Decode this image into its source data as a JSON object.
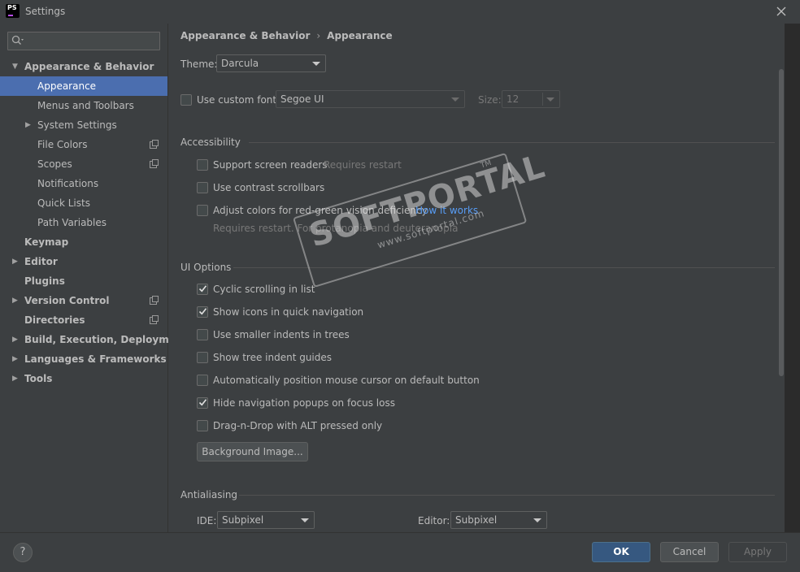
{
  "window": {
    "title": "Settings",
    "app_badge": "PS"
  },
  "sidebar": {
    "search_placeholder": "",
    "items": [
      {
        "label": "Appearance & Behavior",
        "level": 0,
        "bold": true,
        "arrow": "expanded"
      },
      {
        "label": "Appearance",
        "level": 1,
        "selected": true
      },
      {
        "label": "Menus and Toolbars",
        "level": 1
      },
      {
        "label": "System Settings",
        "level": 1,
        "arrow": "collapsed"
      },
      {
        "label": "File Colors",
        "level": 1,
        "project_icon": true
      },
      {
        "label": "Scopes",
        "level": 1,
        "project_icon": true
      },
      {
        "label": "Notifications",
        "level": 1
      },
      {
        "label": "Quick Lists",
        "level": 1
      },
      {
        "label": "Path Variables",
        "level": 1
      },
      {
        "label": "Keymap",
        "level": 0,
        "bold": true
      },
      {
        "label": "Editor",
        "level": 0,
        "bold": true,
        "arrow": "collapsed"
      },
      {
        "label": "Plugins",
        "level": 0,
        "bold": true
      },
      {
        "label": "Version Control",
        "level": 0,
        "bold": true,
        "arrow": "collapsed",
        "project_icon": true
      },
      {
        "label": "Directories",
        "level": 0,
        "bold": true,
        "project_icon": true
      },
      {
        "label": "Build, Execution, Deployment",
        "level": 0,
        "bold": true,
        "arrow": "collapsed"
      },
      {
        "label": "Languages & Frameworks",
        "level": 0,
        "bold": true,
        "arrow": "collapsed"
      },
      {
        "label": "Tools",
        "level": 0,
        "bold": true,
        "arrow": "collapsed"
      }
    ]
  },
  "main": {
    "breadcrumb": [
      "Appearance & Behavior",
      "Appearance"
    ],
    "theme": {
      "label": "Theme:",
      "value": "Darcula"
    },
    "custom_font": {
      "label": "Use custom font:",
      "checked": false,
      "value": "Segoe UI",
      "size_label": "Size:",
      "size_value": "12"
    },
    "accessibility": {
      "title": "Accessibility",
      "screen_readers": {
        "label": "Support screen readers",
        "note": "Requires restart",
        "checked": false
      },
      "contrast_scrollbars": {
        "label": "Use contrast scrollbars",
        "checked": false
      },
      "color_deficiency": {
        "label": "Adjust colors for red-green vision deficiency",
        "link": "How it works",
        "note": "Requires restart. For protanopia and deuteranopia",
        "checked": false
      }
    },
    "ui_options": {
      "title": "UI Options",
      "options": [
        {
          "label": "Cyclic scrolling in list",
          "checked": true
        },
        {
          "label": "Show icons in quick navigation",
          "checked": true
        },
        {
          "label": "Use smaller indents in trees",
          "checked": false
        },
        {
          "label": "Show tree indent guides",
          "checked": false
        },
        {
          "label": "Automatically position mouse cursor on default button",
          "checked": false
        },
        {
          "label": "Hide navigation popups on focus loss",
          "checked": true
        },
        {
          "label": "Drag-n-Drop with ALT pressed only",
          "checked": false
        }
      ],
      "background_button": "Background Image..."
    },
    "antialiasing": {
      "title": "Antialiasing",
      "ide_label": "IDE:",
      "ide_value": "Subpixel",
      "editor_label": "Editor:",
      "editor_value": "Subpixel"
    }
  },
  "footer": {
    "help": "?",
    "ok": "OK",
    "cancel": "Cancel",
    "apply": "Apply"
  },
  "watermark": {
    "brand": "SOFTPORTAL",
    "url": "www.softportal.com",
    "tm": "TM"
  },
  "colors": {
    "accent_selection": "#4b6eaf",
    "link": "#589df6",
    "ok_button": "#365880",
    "panel": "#3c3f41"
  }
}
